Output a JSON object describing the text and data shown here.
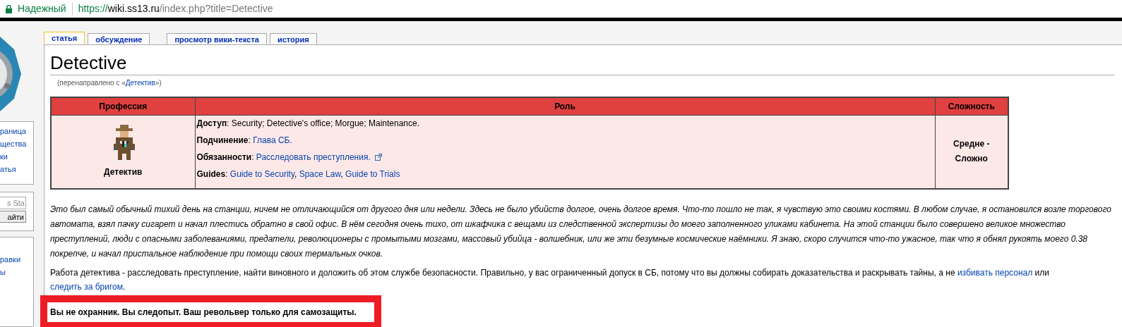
{
  "address_bar": {
    "secure_label": "Надежный",
    "url": {
      "scheme": "https://",
      "host": "wiki.ss13.ru",
      "path": "/index.php?title=Detective"
    }
  },
  "sidebar": {
    "navigation": [
      "раница",
      "щества",
      "ки",
      "атья"
    ],
    "search": {
      "value": "s Sta",
      "button": "айти"
    },
    "toolbox": [
      "равки",
      "ы"
    ]
  },
  "tabs": [
    {
      "label": "статья",
      "selected": true
    },
    {
      "label": "обсуждение",
      "selected": false
    },
    {
      "label": "просмотр вики-текста",
      "selected": false
    },
    {
      "label": "история",
      "selected": false
    }
  ],
  "page": {
    "title": "Detective",
    "redirect": {
      "before": "(перенаправлено с «",
      "link": "Детектив",
      "after": "»)"
    },
    "table": {
      "columns": [
        "Профессия",
        "Роль",
        "Сложность"
      ],
      "profession": "Детектив",
      "role": [
        [
          {
            "kind": "label",
            "text": "Доступ"
          },
          {
            "kind": "text",
            "text": ": Security; Detective's office; Morgue; Maintenance."
          }
        ],
        [
          {
            "kind": "label",
            "text": "Подчинение"
          },
          {
            "kind": "text",
            "text": ": "
          },
          {
            "kind": "link",
            "text": "Глава СБ."
          }
        ],
        [
          {
            "kind": "label",
            "text": "Обязанности"
          },
          {
            "kind": "text",
            "text": ": "
          },
          {
            "kind": "link",
            "text": "Расследовать преступления."
          },
          {
            "kind": "external_icon"
          }
        ],
        [
          {
            "kind": "label",
            "text": "Guides"
          },
          {
            "kind": "text",
            "text": ": "
          },
          {
            "kind": "link",
            "text": "Guide to Security"
          },
          {
            "kind": "text",
            "text": ", "
          },
          {
            "kind": "link",
            "text": "Space Law"
          },
          {
            "kind": "text",
            "text": ", "
          },
          {
            "kind": "link",
            "text": "Guide to Trials"
          }
        ]
      ],
      "difficulty": "Средне - Сложно"
    },
    "intro": "Это был самый обычный тихий день на станции, ничем не отличающийся от другого дня или недели. Здесь не было убийств долгое, очень долгое время. Что-то пошло не так, я чувствую это своими костями. В любом случае, я остановился возле торгового автомата, взял пачку сигарет и начал плестись обратно в свой офис. В нём сегодня очень тихо, от шкафчика с вещами из следственной экспертизы до моего заполненного уликами кабинета. На этой станции было совершено великое множество преступлений, люди с опасными заболеваниями, предатели, революционеры с промытыми мозгами, массовый убийца - волшебник, или же эти безумные космические наёмники. Я знаю, скоро случится что-то ужасное, так что я обнял рукоять моего 0.38 покрепче, и начал пристальное наблюдение при помощи своих термальных очков.",
    "paragraph": [
      {
        "kind": "text",
        "text": "Работа детектива - расследовать преступление, найти виновного и доложить об этом службе безопасности. Правильно, у вас ограниченный допуск в СБ, потому что вы должны собирать доказательства и раскрывать тайны, а не "
      },
      {
        "kind": "link",
        "text": "избивать персонал"
      },
      {
        "kind": "text",
        "text": " или "
      },
      {
        "kind": "link",
        "text": "следить за бригом"
      },
      {
        "kind": "text",
        "text": "."
      }
    ],
    "note": "Вы не охранник. Вы следопыт. Ваш револьвер только для самозащиты."
  }
}
